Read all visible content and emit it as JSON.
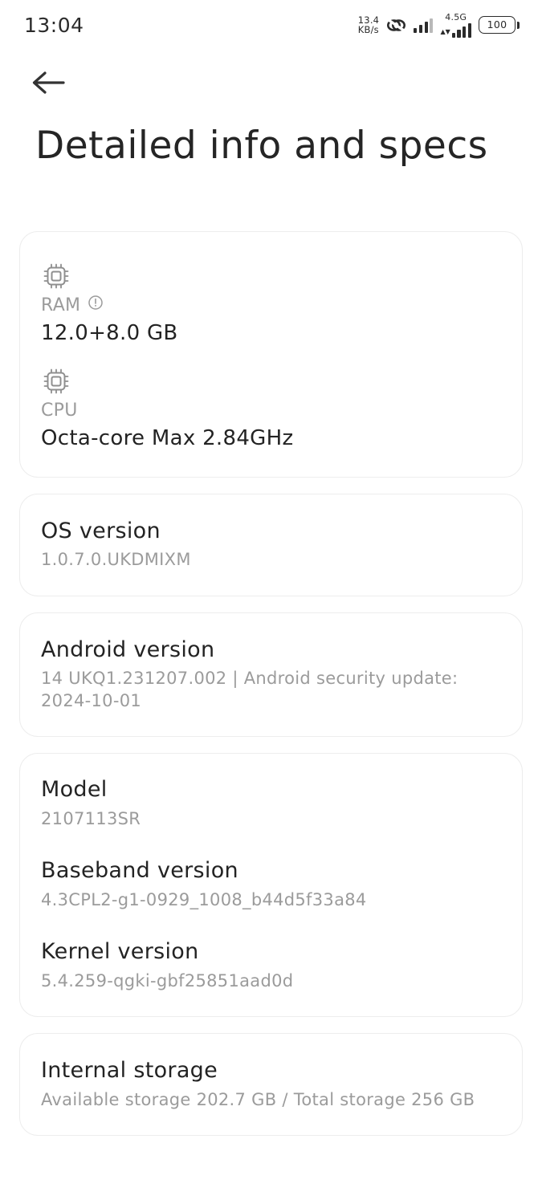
{
  "status_bar": {
    "clock": "13:04",
    "net_speed_value": "13.4",
    "net_speed_unit": "KB/s",
    "vpn_icon": "link-icon",
    "network_label": "4.5G",
    "battery_level": "100"
  },
  "nav": {
    "back_icon": "back-arrow-icon"
  },
  "header": {
    "title": "Detailed info and specs"
  },
  "specs": {
    "ram": {
      "icon": "memory-chip-icon",
      "label": "RAM",
      "info_icon": "info-icon",
      "value": "12.0+8.0 GB"
    },
    "cpu": {
      "icon": "cpu-chip-icon",
      "label": "CPU",
      "value": "Octa-core Max 2.84GHz"
    },
    "os_version": {
      "title": "OS version",
      "value": "1.0.7.0.UKDMIXM"
    },
    "android_version": {
      "title": "Android version",
      "value": "14 UKQ1.231207.002 | Android security update: 2024-10-01"
    },
    "model": {
      "title": "Model",
      "value": "2107113SR"
    },
    "baseband_version": {
      "title": "Baseband version",
      "value": "4.3CPL2-g1-0929_1008_b44d5f33a84"
    },
    "kernel_version": {
      "title": "Kernel version",
      "value": "5.4.259-qgki-gbf25851aad0d"
    },
    "internal_storage": {
      "title": "Internal storage",
      "value": "Available storage  202.7 GB / Total storage  256 GB"
    }
  },
  "colors": {
    "background": "#ffffff",
    "card_border": "#ededed",
    "primary_text": "#232323",
    "secondary_text": "#9b9b9b",
    "status_text": "#2b2b2b"
  }
}
